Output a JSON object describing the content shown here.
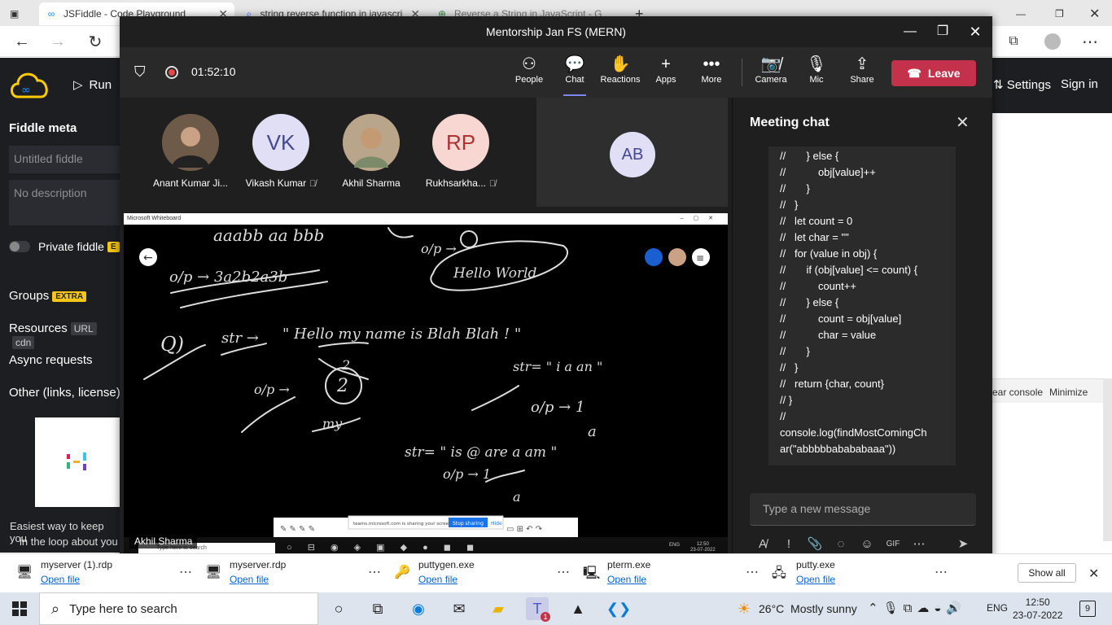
{
  "browser": {
    "tabs": [
      {
        "title": "JSFiddle - Code Playground",
        "icon": "jsfiddle-icon"
      },
      {
        "title": "string reverse function in javascri",
        "icon": "search-icon"
      },
      {
        "title": "Reverse a String in JavaScript - G",
        "icon": "gfg-icon"
      }
    ]
  },
  "jsfiddle": {
    "run_label": "Run",
    "settings_label": "Settings",
    "signin_label": "Sign in",
    "fiddle_meta": "Fiddle meta",
    "title_placeholder": "Untitled fiddle",
    "desc_placeholder": "No description",
    "private_label": "Private fiddle",
    "private_badge": "E",
    "groups_label": "Groups",
    "groups_badge": "EXTRA",
    "resources_label": "Resources",
    "resources_badge1": "URL",
    "resources_badge2": "cdn",
    "async_label": "Async requests",
    "other_label": "Other (links, license)",
    "promo_line1": "Easiest way to keep you",
    "promo_line2": "in the loop about you",
    "clear_console": "ear console",
    "minimize": "Minimize"
  },
  "teams": {
    "window_title": "Mentorship Jan FS (MERN)",
    "timer": "01:52:10",
    "toolbar": [
      {
        "label": "People",
        "icon": "people-icon"
      },
      {
        "label": "Chat",
        "icon": "chat-icon"
      },
      {
        "label": "Reactions",
        "icon": "hand-icon"
      },
      {
        "label": "Apps",
        "icon": "plus-icon"
      },
      {
        "label": "More",
        "icon": "more-icon"
      },
      {
        "label": "Camera",
        "icon": "camera-off-icon"
      },
      {
        "label": "Mic",
        "icon": "mic-icon"
      },
      {
        "label": "Share",
        "icon": "share-icon"
      }
    ],
    "leave_label": "Leave",
    "participants": [
      {
        "name": "Anant Kumar Ji...",
        "initials": "",
        "muted": false,
        "color": "#5a4a3a"
      },
      {
        "name": "Vikash Kumar",
        "initials": "VK",
        "muted": true,
        "color": "#e0dff5"
      },
      {
        "name": "Akhil Sharma",
        "initials": "",
        "muted": false,
        "color": "#8a7560"
      },
      {
        "name": "Rukhsarkha...",
        "initials": "RP",
        "muted": true,
        "color": "#f8d7d3"
      }
    ],
    "ab_initials": "AB",
    "whiteboard_title": "Microsoft Whiteboard",
    "presenter": "Akhil Sharma",
    "share_banner": "teams.microsoft.com is sharing your screen.",
    "stop_sharing": "Stop sharing",
    "hide": "Hide",
    "remote_search": "Type here to search",
    "remote_time": "12:50",
    "remote_date": "23-07-2022",
    "remote_lang": "ENG",
    "chat": {
      "title": "Meeting chat",
      "lines": [
        "//       } else {",
        "//           obj[value]++",
        "//       }",
        "//   }",
        "//   let count = 0",
        "//   let char = \"\"",
        "//   for (value in obj) {",
        "//       if (obj[value] <= count) {",
        "//           count++",
        "//       } else {",
        "//           count = obj[value]",
        "//           char = value",
        "//       }",
        "//   }",
        "//   return {char, count}",
        "// }",
        "//",
        "console.log(findMostComingCh",
        "ar(\"abbbbbabababaaa\"))"
      ],
      "input_placeholder": "Type a new message"
    }
  },
  "whiteboard_text": {
    "t1": "aaabb aa bbb",
    "t2": "o/p → 3a2b2a3b",
    "t3": "o/p →",
    "t4": "Hello World",
    "t5": "Q)",
    "t6": "str →",
    "t7": "\" Hello my name is Blah Blah ! \"",
    "t8": "2",
    "t9": "str= \" i a an \"",
    "t10": "o/p →",
    "t11": "o/p → 1",
    "t12": "a",
    "t13": "my",
    "t14": "str= \" is @ are a am \"",
    "t15": "o/p → 1",
    "t16": "a"
  },
  "downloads": [
    {
      "name": "myserver (1).rdp",
      "action": "Open file",
      "icon": "rdp-icon"
    },
    {
      "name": "myserver.rdp",
      "action": "Open file",
      "icon": "rdp-icon"
    },
    {
      "name": "puttygen.exe",
      "action": "Open file",
      "icon": "puttygen-icon"
    },
    {
      "name": "pterm.exe",
      "action": "Open file",
      "icon": "pterm-icon"
    },
    {
      "name": "putty.exe",
      "action": "Open file",
      "icon": "putty-icon"
    }
  ],
  "show_all": "Show all",
  "taskbar": {
    "search_placeholder": "Type here to search",
    "weather": "26°C  Mostly sunny",
    "lang": "ENG",
    "time": "12:50",
    "date": "23-07-2022",
    "notif_count": "9",
    "teams_badge": "1"
  }
}
